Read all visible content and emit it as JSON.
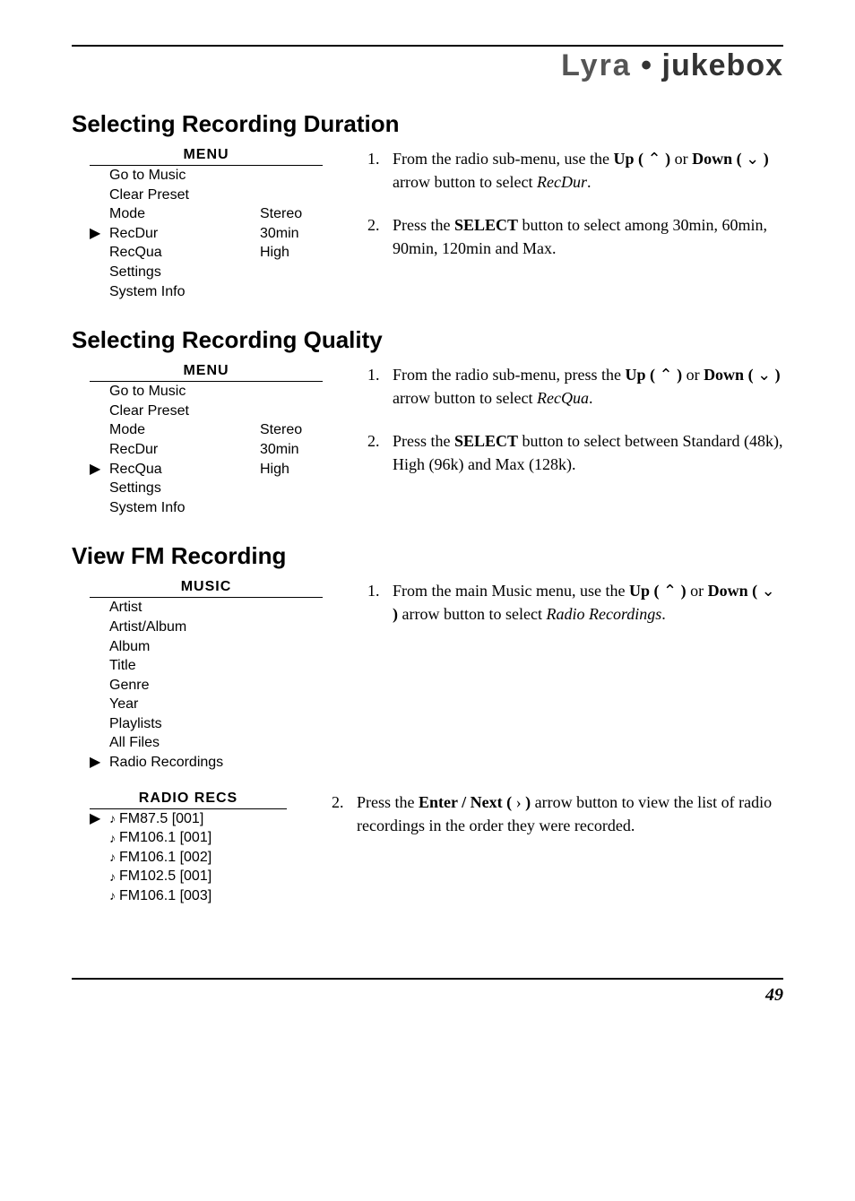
{
  "brand": {
    "left": "Lyra",
    "sep": " • ",
    "right": "jukebox"
  },
  "sections": {
    "recDur": {
      "title": "Selecting Recording Duration",
      "menu": {
        "heading": "MENU",
        "rows": [
          {
            "marker": "",
            "label": "Go to Music",
            "val": ""
          },
          {
            "marker": "",
            "label": "Clear Preset",
            "val": ""
          },
          {
            "marker": "",
            "label": "Mode",
            "val": "Stereo"
          },
          {
            "marker": "▶",
            "label": "RecDur",
            "val": "30min"
          },
          {
            "marker": "",
            "label": "RecQua",
            "val": "High"
          },
          {
            "marker": "",
            "label": "Settings",
            "val": ""
          },
          {
            "marker": "",
            "label": "System Info",
            "val": ""
          }
        ]
      },
      "steps": [
        "From the radio sub-menu, use the <b>Up (</b> ⌃ <b>)</b> or <b>Down (</b> ⌄ <b>)</b> arrow button to select <i>RecDur</i>.",
        "Press the <b>SELECT</b> button to select among 30min, 60min, 90min, 120min and Max."
      ]
    },
    "recQua": {
      "title": "Selecting Recording Quality",
      "menu": {
        "heading": "MENU",
        "rows": [
          {
            "marker": "",
            "label": "Go to Music",
            "val": ""
          },
          {
            "marker": "",
            "label": "Clear Preset",
            "val": ""
          },
          {
            "marker": "",
            "label": "Mode",
            "val": "Stereo"
          },
          {
            "marker": "",
            "label": "RecDur",
            "val": "30min"
          },
          {
            "marker": "▶",
            "label": "RecQua",
            "val": "High"
          },
          {
            "marker": "",
            "label": "Settings",
            "val": ""
          },
          {
            "marker": "",
            "label": "System Info",
            "val": ""
          }
        ]
      },
      "steps": [
        "From the radio sub-menu, press the <b>Up (</b> ⌃ <b>)</b> or <b>Down (</b> ⌄ <b>)</b> arrow button to select <i>RecQua</i>.",
        "Press the <b>SELECT</b> button to select between Standard (48k), High (96k) and Max (128k)."
      ]
    },
    "viewFm": {
      "title": "View FM Recording",
      "musicMenu": {
        "heading": "MUSIC",
        "rows": [
          {
            "marker": "",
            "label": "Artist"
          },
          {
            "marker": "",
            "label": "Artist/Album"
          },
          {
            "marker": "",
            "label": "Album"
          },
          {
            "marker": "",
            "label": "Title"
          },
          {
            "marker": "",
            "label": "Genre"
          },
          {
            "marker": "",
            "label": "Year"
          },
          {
            "marker": "",
            "label": "Playlists"
          },
          {
            "marker": "",
            "label": "All Files"
          },
          {
            "marker": "▶",
            "label": "Radio Recordings"
          }
        ]
      },
      "radioMenu": {
        "heading": "RADIO RECS",
        "rows": [
          {
            "marker": "▶",
            "icon": "♪",
            "label": "FM87.5 [001]"
          },
          {
            "marker": "",
            "icon": "♪",
            "label": "FM106.1 [001]"
          },
          {
            "marker": "",
            "icon": "♪",
            "label": "FM106.1 [002]"
          },
          {
            "marker": "",
            "icon": "♪",
            "label": "FM102.5 [001]"
          },
          {
            "marker": "",
            "icon": "♪",
            "label": "FM106.1 [003]"
          }
        ]
      },
      "steps1": [
        "From the main Music menu, use the <b>Up (</b> ⌃ <b>)</b> or <b>Down (</b> ⌄ <b>)</b> arrow button to select <i>Radio Recordings</i>."
      ],
      "steps2": [
        "Press the <b>Enter / Next (</b> › <b>)</b> arrow button to view the list of radio recordings in the order they were recorded."
      ]
    }
  },
  "pageNumber": "49"
}
